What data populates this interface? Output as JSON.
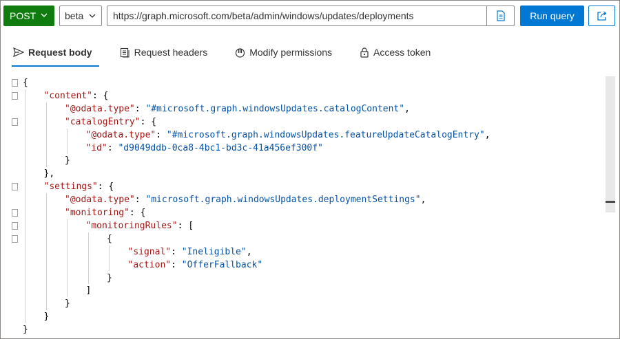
{
  "toolbar": {
    "method": "POST",
    "version": "beta",
    "url": "https://graph.microsoft.com/beta/admin/windows/updates/deployments",
    "run_label": "Run query"
  },
  "tabs": [
    {
      "label": "Request body",
      "icon": "send-icon",
      "active": true
    },
    {
      "label": "Request headers",
      "icon": "headers-icon",
      "active": false
    },
    {
      "label": "Modify permissions",
      "icon": "permissions-icon",
      "active": false
    },
    {
      "label": "Access token",
      "icon": "lock-icon",
      "active": false
    }
  ],
  "colors": {
    "method": "#107c10",
    "run": "#0078d4",
    "key": "#a31515",
    "string": "#0451a5"
  },
  "code": [
    [
      [
        "p",
        "{"
      ]
    ],
    [
      [
        "k",
        "\"content\""
      ],
      [
        "p",
        ": {"
      ]
    ],
    [
      [
        "k",
        "\"@odata.type\""
      ],
      [
        "p",
        ": "
      ],
      [
        "s",
        "\"#microsoft.graph.windowsUpdates.catalogContent\""
      ],
      [
        "p",
        ","
      ]
    ],
    [
      [
        "k",
        "\"catalogEntry\""
      ],
      [
        "p",
        ": {"
      ]
    ],
    [
      [
        "k",
        "\"@odata.type\""
      ],
      [
        "p",
        ": "
      ],
      [
        "s",
        "\"#microsoft.graph.windowsUpdates.featureUpdateCatalogEntry\""
      ],
      [
        "p",
        ","
      ]
    ],
    [
      [
        "k",
        "\"id\""
      ],
      [
        "p",
        ": "
      ],
      [
        "s",
        "\"d9049ddb-0ca8-4bc1-bd3c-41a456ef300f\""
      ]
    ],
    [
      [
        "p",
        "}"
      ]
    ],
    [
      [
        "p",
        "},"
      ]
    ],
    [
      [
        "k",
        "\"settings\""
      ],
      [
        "p",
        ": {"
      ]
    ],
    [
      [
        "k",
        "\"@odata.type\""
      ],
      [
        "p",
        ": "
      ],
      [
        "s",
        "\"microsoft.graph.windowsUpdates.deploymentSettings\""
      ],
      [
        "p",
        ","
      ]
    ],
    [
      [
        "k",
        "\"monitoring\""
      ],
      [
        "p",
        ": {"
      ]
    ],
    [
      [
        "k",
        "\"monitoringRules\""
      ],
      [
        "p",
        ": ["
      ]
    ],
    [
      [
        "p",
        "{"
      ]
    ],
    [
      [
        "k",
        "\"signal\""
      ],
      [
        "p",
        ": "
      ],
      [
        "s",
        "\"Ineligible\""
      ],
      [
        "p",
        ","
      ]
    ],
    [
      [
        "k",
        "\"action\""
      ],
      [
        "p",
        ": "
      ],
      [
        "s",
        "\"OfferFallback\""
      ]
    ],
    [
      [
        "p",
        "}"
      ]
    ],
    [
      [
        "p",
        "]"
      ]
    ],
    [
      [
        "p",
        "}"
      ]
    ],
    [
      [
        "p",
        "}"
      ]
    ],
    [
      [
        "p",
        "}"
      ]
    ]
  ]
}
